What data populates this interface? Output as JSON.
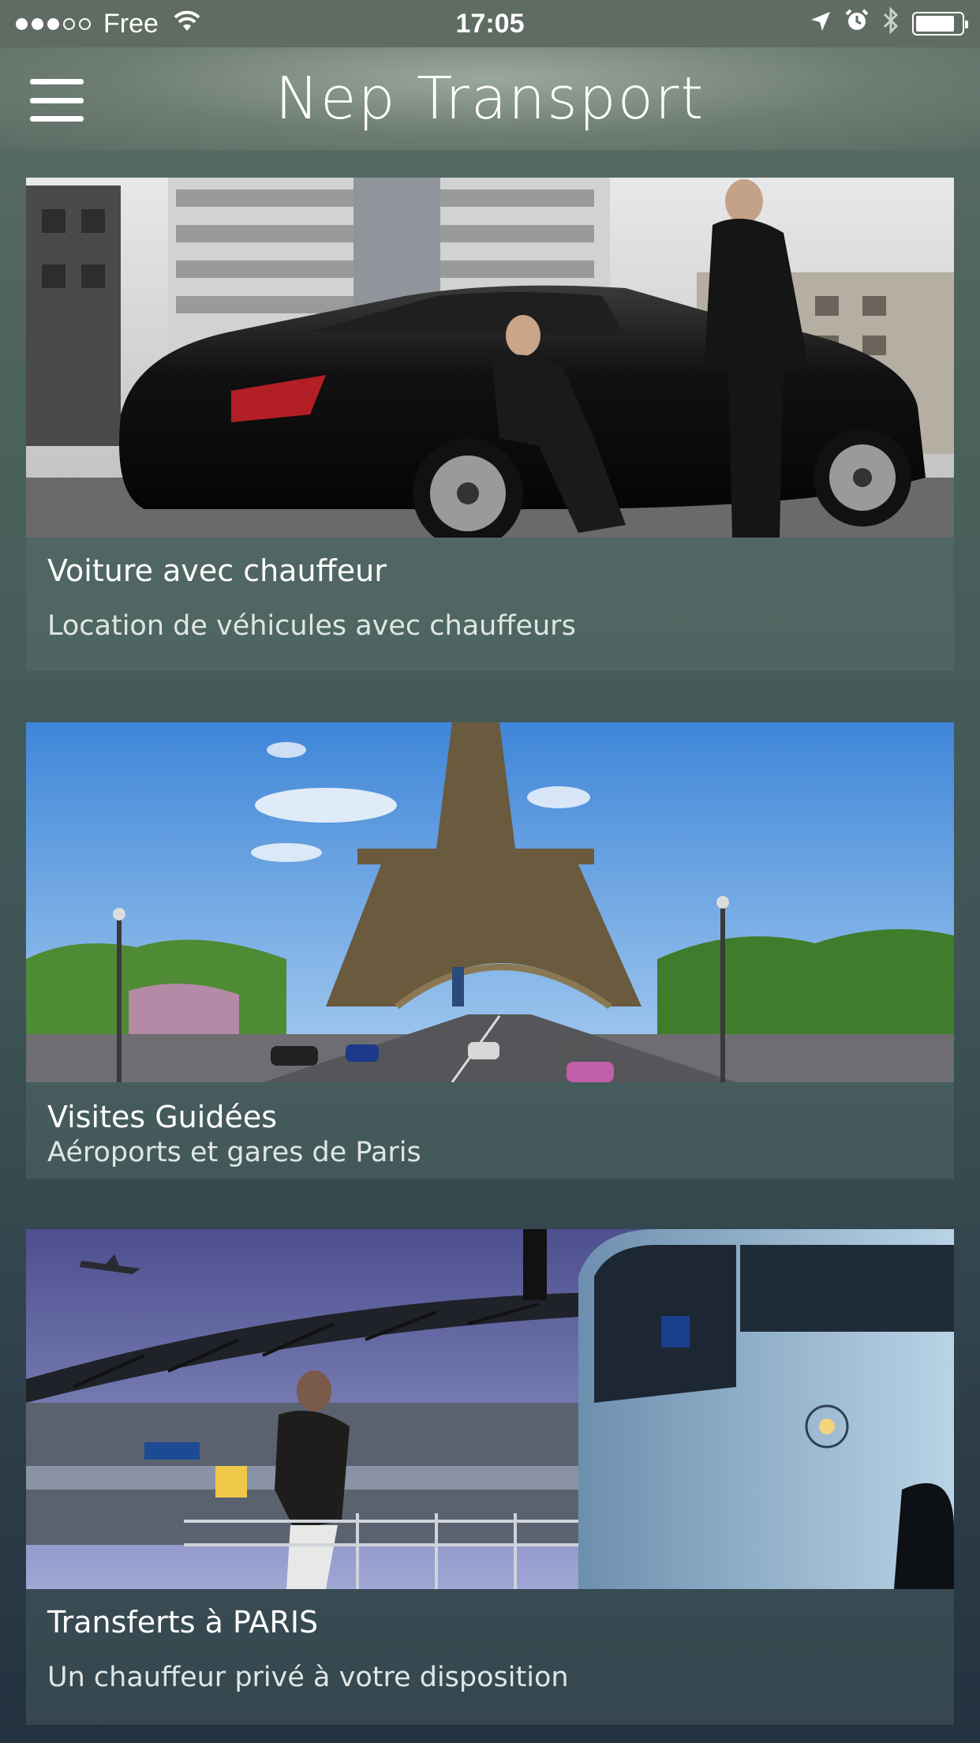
{
  "status_bar": {
    "carrier": "Free",
    "time": "17:05",
    "signal_bars_filled": 3,
    "signal_bars_total": 5,
    "battery_level": 0.85
  },
  "header": {
    "title": "Nep Transport",
    "menu_icon": "hamburger-menu-icon"
  },
  "services": [
    {
      "title": "Voiture avec chauffeur",
      "subtitle": "Location de véhicules avec chauffeurs",
      "image": "black-limousine-chauffeur-photo"
    },
    {
      "title": "Visites Guidées",
      "subtitle": "Aéroports et gares de Paris",
      "image": "eiffel-tower-photo"
    },
    {
      "title": "Transferts à PARIS",
      "subtitle": "Un chauffeur privé à votre disposition",
      "image": "airport-bus-photo"
    }
  ],
  "colors": {
    "status_bar_bg": "#5f6c63",
    "background_top": "#5c6f66",
    "background_bottom": "#233240"
  }
}
